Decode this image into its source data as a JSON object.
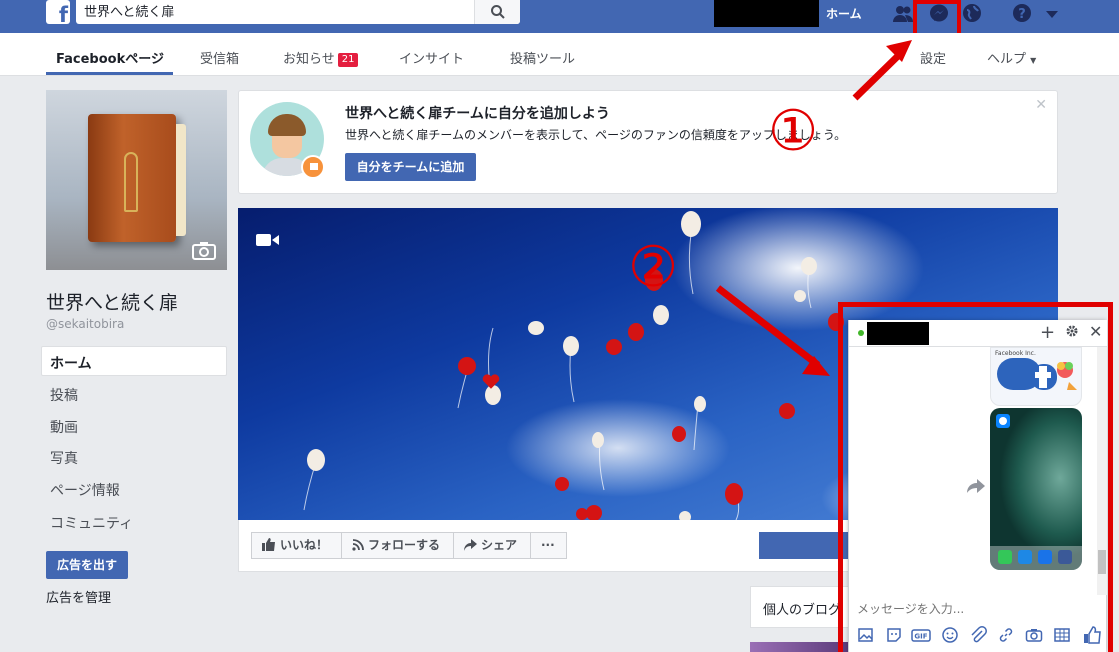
{
  "topbar": {
    "search_value": "世界へと続く扉",
    "home_label": "ホーム"
  },
  "subnav": {
    "tabs": [
      {
        "label": "Facebookページ"
      },
      {
        "label": "受信箱"
      },
      {
        "label": "お知らせ",
        "badge": "21"
      },
      {
        "label": "インサイト"
      },
      {
        "label": "投稿ツール"
      }
    ],
    "settings": "設定",
    "help": "ヘルプ"
  },
  "page": {
    "name": "世界へと続く扉",
    "handle": "@sekaitobira",
    "menu": [
      "ホーム",
      "投稿",
      "動画",
      "写真",
      "ページ情報",
      "コミュニティ"
    ],
    "ad_button": "広告を出す",
    "ad_manage": "広告を管理"
  },
  "team_card": {
    "title": "世界へと続く扉チームに自分を追加しよう",
    "desc": "世界へと続く扉チームのメンバーを表示して、ページのファンの信頼度をアップしましょう。",
    "button": "自分をチームに追加"
  },
  "actions": {
    "like": "いいね！",
    "follow": "フォローする",
    "share": "シェア",
    "more": "···"
  },
  "sidebar_cards": {
    "blog": "個人のブログ"
  },
  "chat": {
    "placeholder": "メッセージを入力...",
    "mini_label": "Facebook Inc."
  },
  "annotations": {
    "one": "①",
    "two": "②"
  },
  "colors": {
    "brand": "#4267b2",
    "annotation": "#e00000",
    "badge": "#e41e3f"
  }
}
